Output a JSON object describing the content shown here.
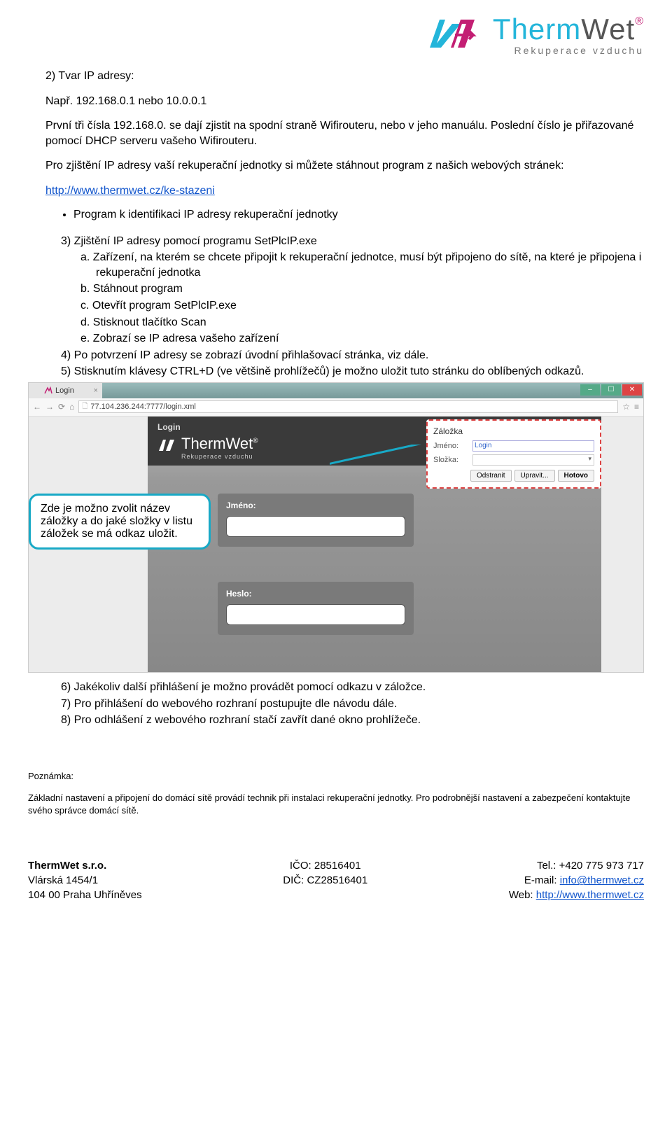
{
  "logo": {
    "brand_therm": "Therm",
    "brand_wet": "Wet",
    "reg": "®",
    "tagline": "Rekuperace vzduchu"
  },
  "body": {
    "s2_heading": "2)  Tvar IP adresy:",
    "example": "Např. 192.168.0.1 nebo 10.0.0.1",
    "p1": "První tři čísla 192.168.0. se dají zjistit na spodní straně Wifirouteru, nebo v jeho manuálu. Poslední číslo je přiřazované pomocí DHCP serveru vašeho Wifirouteru.",
    "p2": "Pro zjištění IP adresy vaší rekuperační jednotky si můžete stáhnout program z našich webových stránek:",
    "link": "http://www.thermwet.cz/ke-stazeni",
    "bullet": "Program k identifikaci IP adresy rekuperační jednotky",
    "s3_heading": "3)  Zjištění IP adresy pomocí programu SetPlcIP.exe",
    "s3a": "a.  Zařízení, na kterém se chcete připojit k rekuperační jednotce, musí být připojeno do sítě, na které je připojena i rekuperační jednotka",
    "s3b": "b.  Stáhnout program",
    "s3c": "c.  Otevřít program SetPlcIP.exe",
    "s3d": "d.  Stisknout tlačítko Scan",
    "s3e": "e.  Zobrazí se IP adresa vašeho zařízení",
    "s4": "4)  Po potvrzení IP adresy se zobrazí úvodní přihlašovací stránka, viz dále.",
    "s5": "5)  Stisknutím klávesy CTRL+D (ve většině prohlížečů) je možno uložit tuto stránku do oblíbených odkazů.",
    "s6": "6)  Jakékoliv další přihlášení je možno provádět pomocí odkazu v záložce.",
    "s7": "7)  Pro přihlášení do webového rozhraní postupujte dle návodu dále.",
    "s8": "8)  Pro odhlášení z webového rozhraní stačí zavřít dané okno prohlížeče."
  },
  "shot": {
    "tab_title": "Login",
    "url": "77.104.236.244:7777/login.xml",
    "main_login": "Login",
    "brand_full": "ThermWet",
    "brand_sub": "Rekuperace vzduchu",
    "field_user": "Jméno:",
    "field_pass": "Heslo:",
    "callout": "Zde je možno zvolit název záložky a do jaké složky v listu záložek se má odkaz uložit.",
    "popup": {
      "title": "Záložka",
      "row1_label": "Jméno:",
      "row1_value": "Login",
      "row2_label": "Složka:",
      "btn_remove": "Odstranit",
      "btn_edit": "Upravit...",
      "btn_done": "Hotovo"
    }
  },
  "note": {
    "heading": "Poznámka:",
    "text": "Základní nastavení a připojení do domácí sítě provádí technik při instalaci rekuperační jednotky. Pro podrobnější nastavení a zabezpečení kontaktujte svého správce domácí sítě."
  },
  "footer": {
    "company": "ThermWet s.r.o.",
    "street": "Vlárská 1454/1",
    "city": "104 00 Praha Uhříněves",
    "ico": "IČO: 28516401",
    "dic": "DIČ: CZ28516401",
    "tel": "Tel.: +420 775 973 717",
    "email_label": "E-mail: ",
    "email": "info@thermwet.cz",
    "web_label": "Web: ",
    "web": "http://www.thermwet.cz"
  }
}
